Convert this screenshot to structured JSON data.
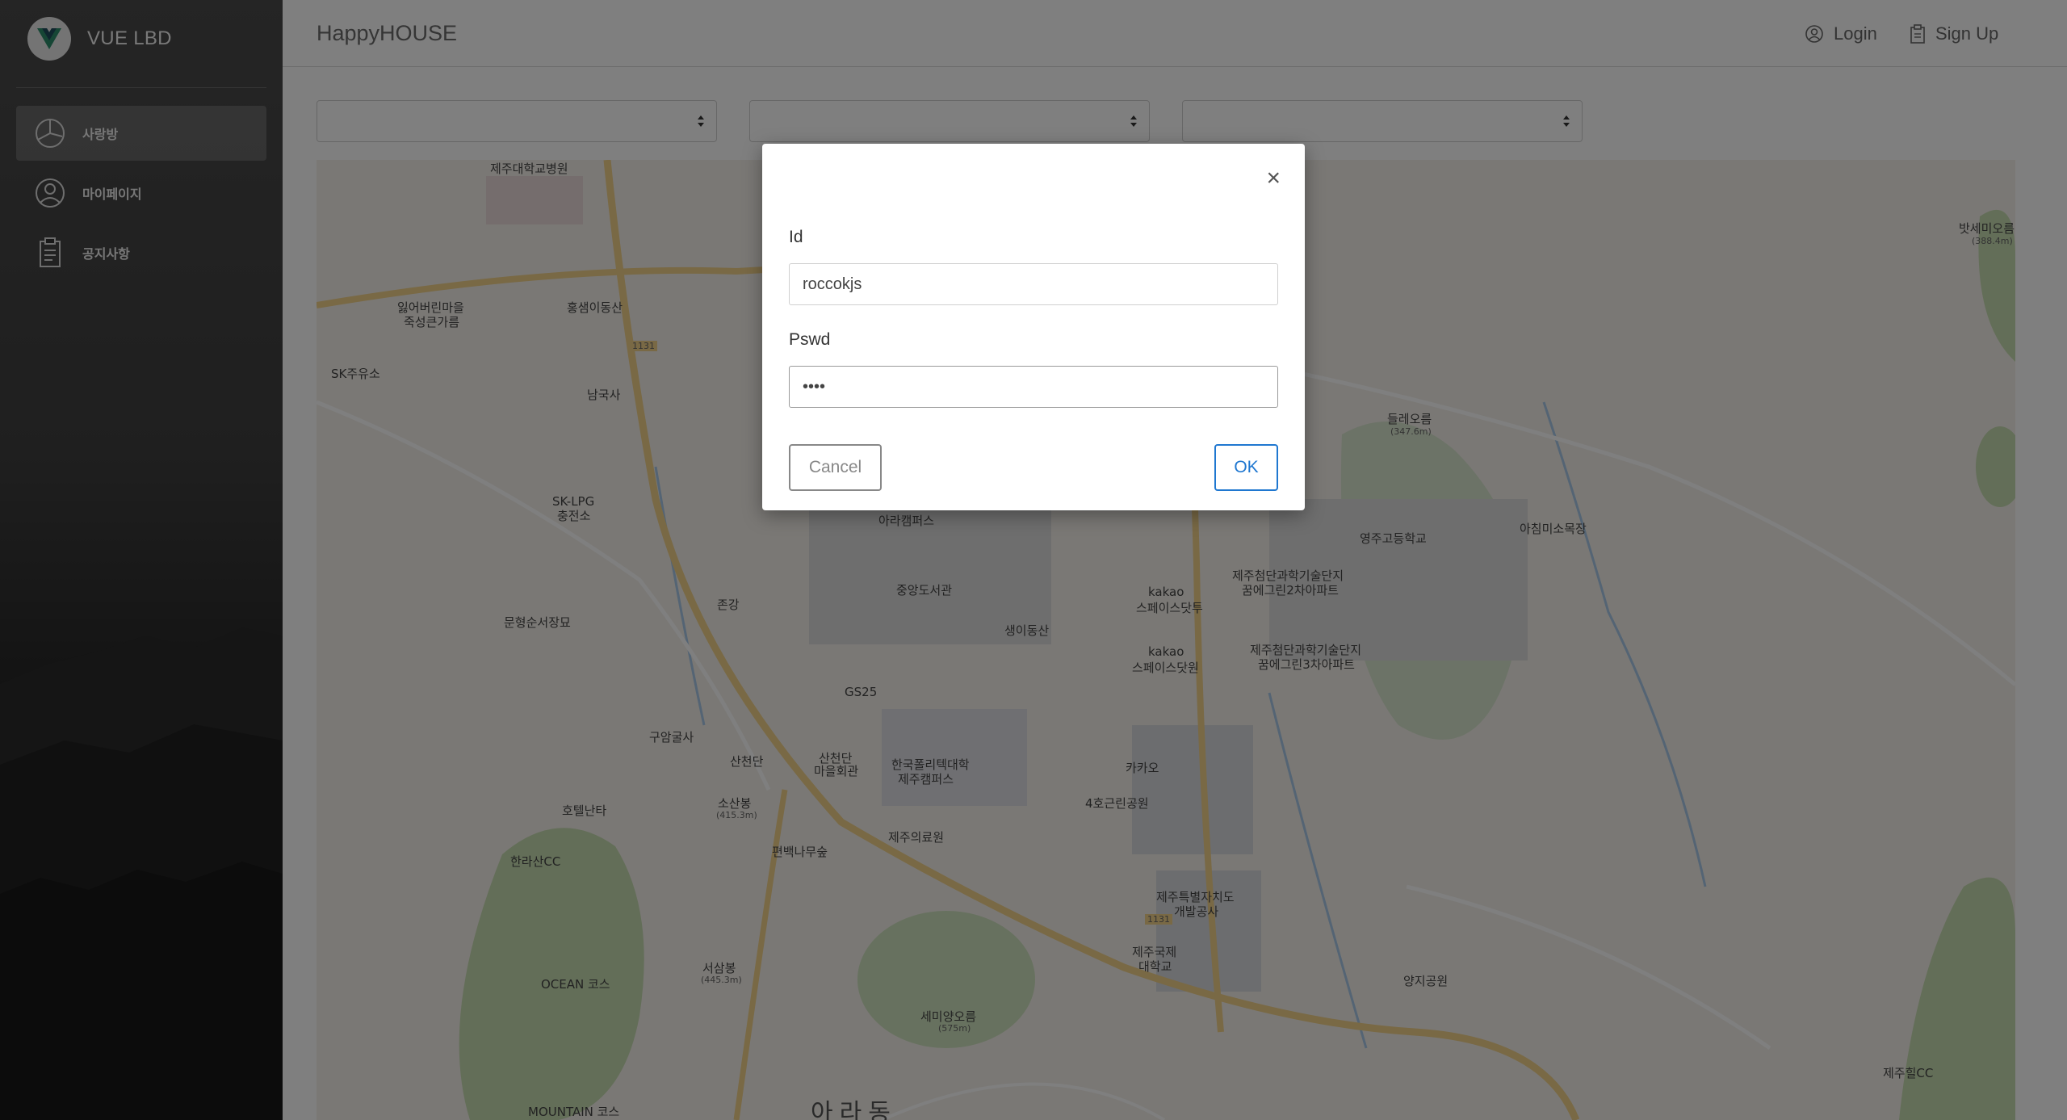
{
  "sidebar": {
    "brand": "VUE LBD",
    "items": [
      {
        "label": "사랑방",
        "icon": "pie-chart-icon",
        "active": true
      },
      {
        "label": "마이페이지",
        "icon": "user-circle-icon",
        "active": false
      },
      {
        "label": "공지사항",
        "icon": "clipboard-icon",
        "active": false
      }
    ]
  },
  "header": {
    "title": "HappyHOUSE",
    "login_label": "Login",
    "signup_label": "Sign Up"
  },
  "filters": [
    {
      "value": ""
    },
    {
      "value": ""
    },
    {
      "value": ""
    }
  ],
  "map": {
    "labels": [
      "제주대학교병원",
      "잃어버린마을",
      "죽성큰가름",
      "홍샘이동산",
      "SK주유소",
      "남국사",
      "SK-LPG",
      "충전소",
      "문형순서장묘",
      "아라캠퍼스",
      "중앙도서관",
      "존강",
      "생이동산",
      "GS25",
      "구암굴사",
      "산천단",
      "산천단",
      "마을회관",
      "한국폴리텍대학",
      "제주캠퍼스",
      "소산봉",
      "(415.3m)",
      "호텔난타",
      "한라산CC",
      "편백나무숲",
      "제주의료원",
      "OCEAN 코스",
      "서삼봉",
      "(445.3m)",
      "세미양오름",
      "(575m)",
      "MOUNTAIN 코스",
      "아라동",
      "kakao",
      "스페이스닷투",
      "kakao",
      "스페이스닷원",
      "카카오",
      "4호근린공원",
      "제주특별자치도",
      "개발공사",
      "제주국제",
      "대학교",
      "제주첨단과학기술단지",
      "꿈에그린2차아파트",
      "제주첨단과학기술단지",
      "꿈에그린3차아파트",
      "영주고등학교",
      "들레오름",
      "(347.6m)",
      "아침미소목장",
      "양지공원",
      "제주힐CC",
      "밧세미오름",
      "(388.4m)",
      "1131",
      "1131"
    ]
  },
  "modal": {
    "id_label": "Id",
    "id_value": "roccokjs",
    "pswd_label": "Pswd",
    "pswd_value": "••••",
    "cancel_label": "Cancel",
    "ok_label": "OK",
    "close_symbol": "×"
  },
  "colors": {
    "accent": "#1f77d0",
    "overlay": "rgba(0,0,0,0.5)"
  }
}
